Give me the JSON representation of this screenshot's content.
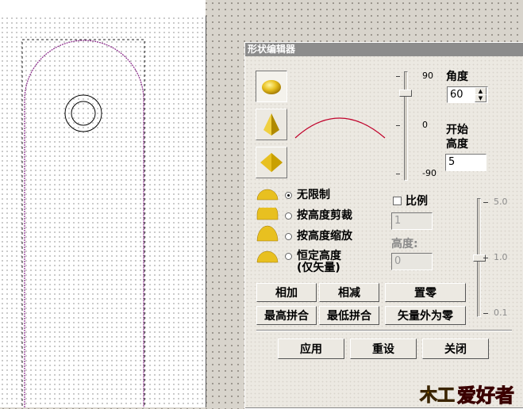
{
  "dialog": {
    "title": "形状编辑器",
    "angle_label": "角度",
    "angle_value": "60",
    "start_height_label_1": "开始",
    "start_height_label_2": "高度",
    "start_height_value": "5",
    "angle_slider": {
      "max_label": "90",
      "mid_label": "0",
      "min_label": "-90",
      "value": 60
    },
    "modes": [
      {
        "label": "无限制",
        "checked": true
      },
      {
        "label": "按高度剪裁",
        "checked": false
      },
      {
        "label": "按高度缩放",
        "checked": false
      },
      {
        "label": "恒定高度",
        "label2": "(仅矢量)",
        "checked": false
      }
    ],
    "ratio_label": "比例",
    "ratio_checked": false,
    "ratio_value": "1",
    "height_label": "高度:",
    "height_value": "0",
    "scale_slider": {
      "max_label": "5.0",
      "mid_label": "1.0",
      "min_label": "0.1",
      "value": 1.0
    },
    "buttons": {
      "add": "相加",
      "subtract": "相减",
      "zero": "置零",
      "max_merge": "最高拼合",
      "min_merge": "最低拼合",
      "vector_outer_zero": "矢量外为零",
      "apply": "应用",
      "reset": "重设",
      "close": "关闭"
    }
  },
  "watermark": {
    "text": "爱好者",
    "mark": "木工"
  },
  "colors": {
    "accent": "#8b0021",
    "titlebar": "#8c8c8c",
    "gold": "#e8c020"
  },
  "icons": [
    "dome-shape-icon",
    "pyramid-shape-icon",
    "diamond-shape-icon",
    "mode-dome-icon"
  ]
}
